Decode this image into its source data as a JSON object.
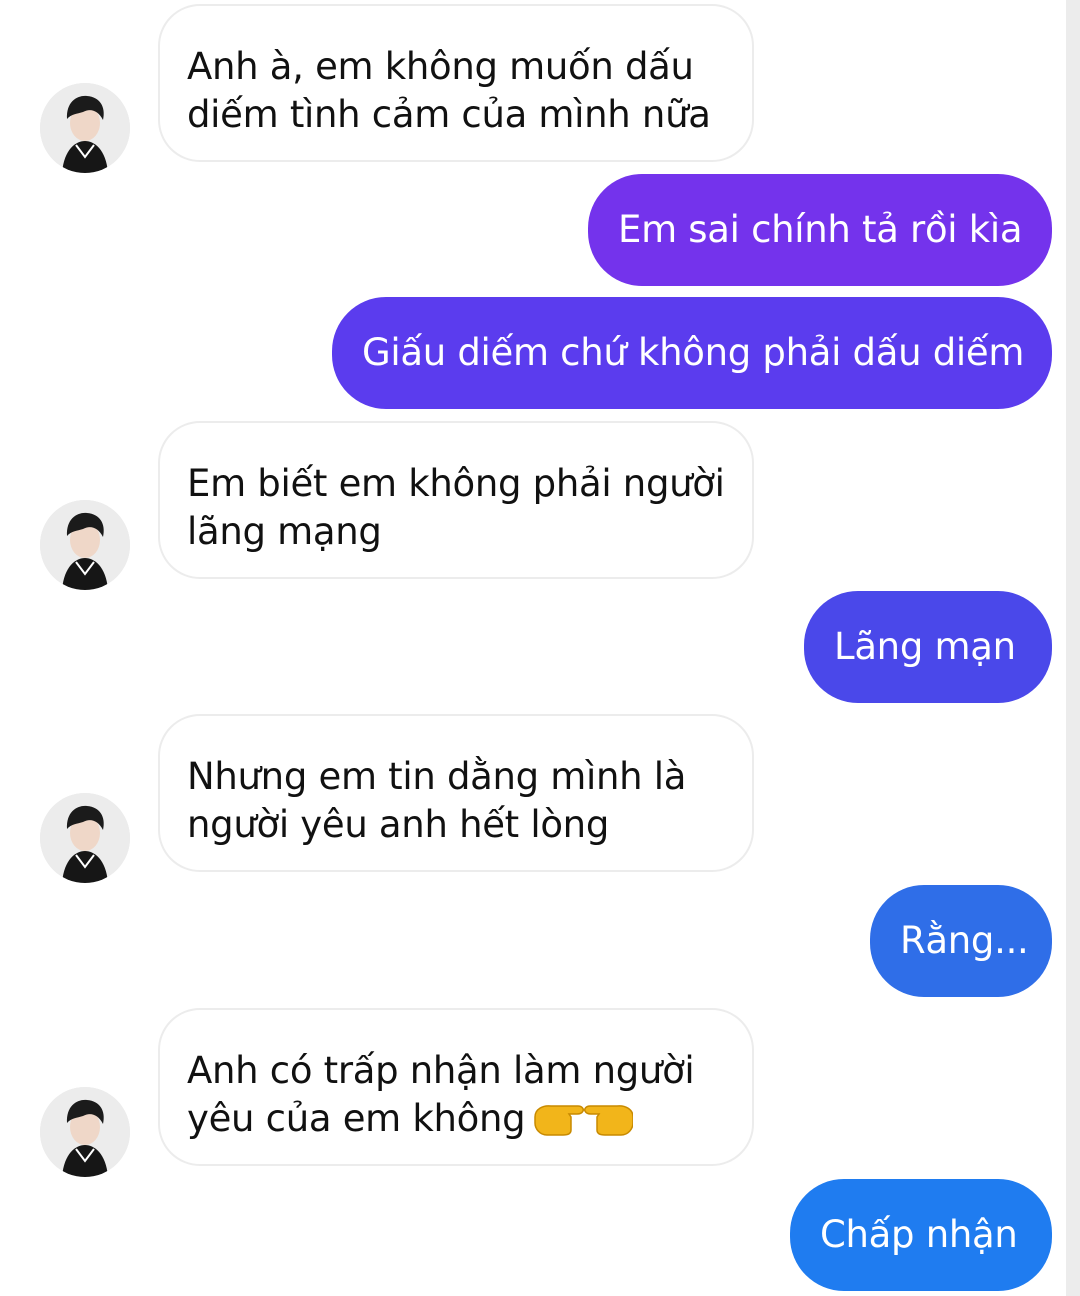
{
  "colors": {
    "incoming_bg": "#ffffff",
    "incoming_border": "#ececec",
    "outgoing_purple": "#7433ec",
    "outgoing_indigo": "#5b3cee",
    "outgoing_blue": "#2f6ee8",
    "outgoing_light_blue": "#1f7cf0"
  },
  "messages": [
    {
      "side": "incoming",
      "lines": [
        "Anh à, em không muốn dấu",
        "diếm tình cảm của mình nữa"
      ]
    },
    {
      "side": "outgoing",
      "text": "Em sai chính tả rồi kìa"
    },
    {
      "side": "outgoing",
      "text": "Giấu diếm chứ không phải dấu diếm"
    },
    {
      "side": "incoming",
      "lines": [
        "Em biết em không phải người",
        "lãng mạng"
      ]
    },
    {
      "side": "outgoing",
      "text": "Lãng mạn"
    },
    {
      "side": "incoming",
      "lines": [
        "Nhưng em tin dằng mình là",
        "người yêu anh hết lòng"
      ]
    },
    {
      "side": "outgoing",
      "text": "Rằng..."
    },
    {
      "side": "incoming",
      "lines": [
        "Anh có trấp nhận làm người",
        "yêu của em không"
      ],
      "emoji": "pointing-hands-icon"
    },
    {
      "side": "outgoing",
      "text": "Chấp nhận"
    }
  ]
}
